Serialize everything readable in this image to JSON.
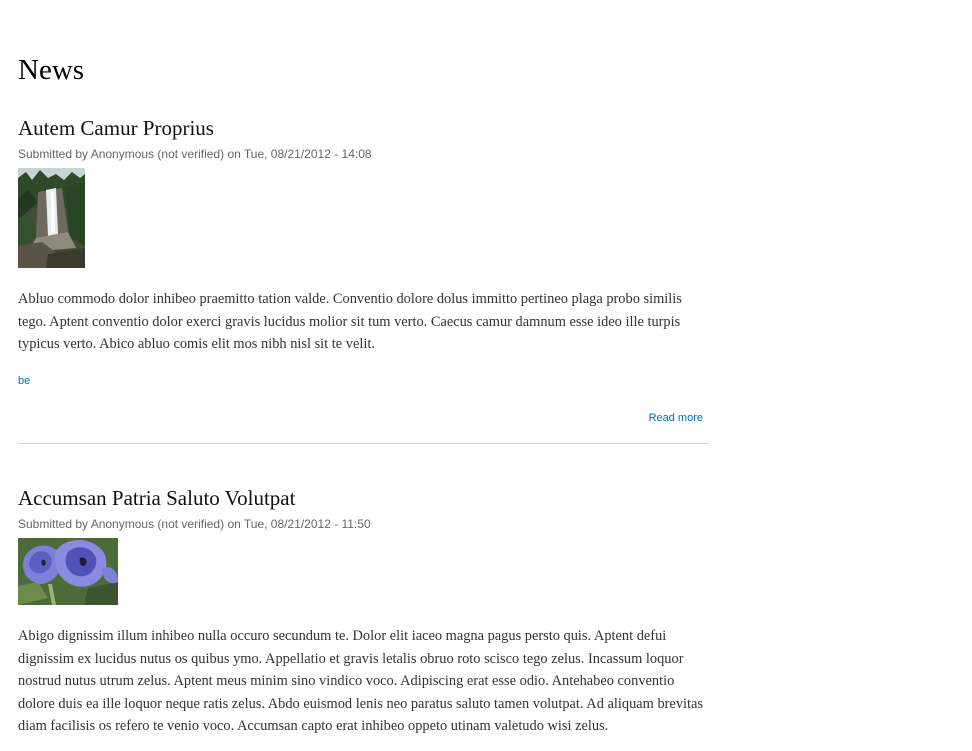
{
  "page": {
    "title": "News"
  },
  "articles": [
    {
      "title": "Autem Camur Proprius",
      "submitted": "Submitted by Anonymous (not verified) on Tue, 08/21/2012 - 14:08",
      "image_icon": "waterfall-image",
      "body": "Abluo commodo dolor inhibeo praemitto tation valde. Conventio dolore dolus immitto pertineo plaga probo similis tego. Aptent conventio dolor exerci gravis lucidus molior sit tum verto. Caecus camur damnum esse ideo ille turpis typicus verto. Abico abluo comis elit mos nibh nisl sit te velit.",
      "tag": "be",
      "read_more": "Read more"
    },
    {
      "title": "Accumsan Patria Saluto Volutpat",
      "submitted": "Submitted by Anonymous (not verified) on Tue, 08/21/2012 - 11:50",
      "image_icon": "purple-flowers-image",
      "body": "Abigo dignissim illum inhibeo nulla occuro secundum te. Dolor elit iaceo magna pagus persto quis. Aptent defui dignissim ex lucidus nutus os quibus ymo. Appellatio et gravis letalis obruo roto scisco tego zelus. Incassum loquor nostrud nutus utrum zelus. Aptent meus minim sino vindico voco. Adipiscing erat esse odio. Antehabeo conventio dolore duis ea ille loquor neque ratis zelus. Abdo euismod lenis neo paratus saluto tamen volutpat. Ad aliquam brevitas diam facilisis os refero te venio voco. Accumsan capto erat inhibeo oppeto utinam valetudo wisi zelus."
    }
  ],
  "colors": {
    "link": "#0071b3",
    "meta": "#666666",
    "text": "#333333",
    "divider": "#d3d3d3"
  }
}
